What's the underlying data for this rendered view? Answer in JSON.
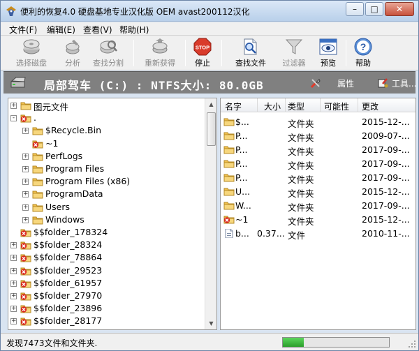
{
  "window": {
    "title": "便利的恢复4.0 硬盘基地专业汉化版 OEM avast200112汉化",
    "app_icon": "eagle-icon",
    "controls": [
      "minimize-icon",
      "maximize-icon",
      "close-icon"
    ]
  },
  "menu": {
    "items": [
      "文件(F)",
      "编辑(E)",
      "查看(V)",
      "帮助(H)"
    ]
  },
  "toolbar": {
    "items": [
      {
        "label": "选择磁盘",
        "icon": "disk-icon",
        "enabled": false
      },
      {
        "label": "分析",
        "icon": "analyze-icon",
        "enabled": false
      },
      {
        "label": "查找分割",
        "icon": "find-partition-icon",
        "enabled": false
      },
      {
        "label": "重新获得",
        "icon": "recover-icon",
        "enabled": false
      },
      {
        "label": "停止",
        "icon": "stop-icon",
        "enabled": true,
        "icon_text": "STOP"
      },
      {
        "label": "查找文件",
        "icon": "find-file-icon",
        "enabled": true
      },
      {
        "label": "过滤器",
        "icon": "filter-icon",
        "enabled": false
      },
      {
        "label": "预览",
        "icon": "preview-icon",
        "enabled": true
      },
      {
        "label": "帮助",
        "icon": "help-icon",
        "enabled": true,
        "icon_text": "?"
      }
    ]
  },
  "drivebar": {
    "text": "局部驾车 (C:) : NTFS大小: 80.0GB",
    "properties_label": "属性",
    "tools_label": "工具..."
  },
  "tree": {
    "rows": [
      {
        "label": "图元文件",
        "level": 0,
        "expander": "+",
        "icon": "folder-icon"
      },
      {
        "label": ".",
        "level": 0,
        "expander": "-",
        "icon": "deleted-folder-icon"
      },
      {
        "label": "$Recycle.Bin",
        "level": 1,
        "expander": "+",
        "icon": "folder-icon"
      },
      {
        "label": "~1",
        "level": 1,
        "expander": "",
        "icon": "deleted-folder-icon"
      },
      {
        "label": "PerfLogs",
        "level": 1,
        "expander": "+",
        "icon": "folder-icon"
      },
      {
        "label": "Program Files",
        "level": 1,
        "expander": "+",
        "icon": "folder-icon"
      },
      {
        "label": "Program Files (x86)",
        "level": 1,
        "expander": "+",
        "icon": "folder-icon"
      },
      {
        "label": "ProgramData",
        "level": 1,
        "expander": "+",
        "icon": "folder-icon"
      },
      {
        "label": "Users",
        "level": 1,
        "expander": "+",
        "icon": "folder-icon"
      },
      {
        "label": "Windows",
        "level": 1,
        "expander": "+",
        "icon": "folder-icon"
      },
      {
        "label": "$$folder_178324",
        "level": 0,
        "expander": "",
        "icon": "deleted-folder-icon"
      },
      {
        "label": "$$folder_28324",
        "level": 0,
        "expander": "+",
        "icon": "deleted-folder-icon"
      },
      {
        "label": "$$folder_78864",
        "level": 0,
        "expander": "+",
        "icon": "deleted-folder-icon"
      },
      {
        "label": "$$folder_29523",
        "level": 0,
        "expander": "+",
        "icon": "deleted-folder-icon"
      },
      {
        "label": "$$folder_61957",
        "level": 0,
        "expander": "+",
        "icon": "deleted-folder-icon"
      },
      {
        "label": "$$folder_27970",
        "level": 0,
        "expander": "+",
        "icon": "deleted-folder-icon"
      },
      {
        "label": "$$folder_23896",
        "level": 0,
        "expander": "+",
        "icon": "deleted-folder-icon"
      },
      {
        "label": "$$folder_28177",
        "level": 0,
        "expander": "+",
        "icon": "deleted-folder-icon"
      }
    ]
  },
  "list": {
    "columns": [
      "名字",
      "大小",
      "类型",
      "可能性",
      "更改"
    ],
    "rows": [
      {
        "name": "$...",
        "size": "",
        "type": "文件夹",
        "prob": "",
        "date": "2015-12-...",
        "icon": "folder-icon"
      },
      {
        "name": "P...",
        "size": "",
        "type": "文件夹",
        "prob": "",
        "date": "2009-07-...",
        "icon": "folder-icon"
      },
      {
        "name": "P...",
        "size": "",
        "type": "文件夹",
        "prob": "",
        "date": "2017-09-...",
        "icon": "folder-icon"
      },
      {
        "name": "P...",
        "size": "",
        "type": "文件夹",
        "prob": "",
        "date": "2017-09-...",
        "icon": "folder-icon"
      },
      {
        "name": "P...",
        "size": "",
        "type": "文件夹",
        "prob": "",
        "date": "2017-09-...",
        "icon": "folder-icon"
      },
      {
        "name": "U...",
        "size": "",
        "type": "文件夹",
        "prob": "",
        "date": "2015-12-...",
        "icon": "folder-icon"
      },
      {
        "name": "W...",
        "size": "",
        "type": "文件夹",
        "prob": "",
        "date": "2017-09-...",
        "icon": "folder-icon"
      },
      {
        "name": "~1",
        "size": "",
        "type": "文件夹",
        "prob": "",
        "date": "2015-12-...",
        "icon": "deleted-folder-icon"
      },
      {
        "name": "b...",
        "size": "0.37...",
        "type": "文件",
        "prob": "",
        "date": "2010-11-...",
        "icon": "file-icon"
      }
    ]
  },
  "status": {
    "text": "发现7473文件和文件夹.",
    "progress": 0.2
  },
  "colors": {
    "folder": "#f2c14e",
    "deleted_marker": "#d9281f",
    "drivebar": "#808080",
    "progress": "#2a9e2a"
  }
}
